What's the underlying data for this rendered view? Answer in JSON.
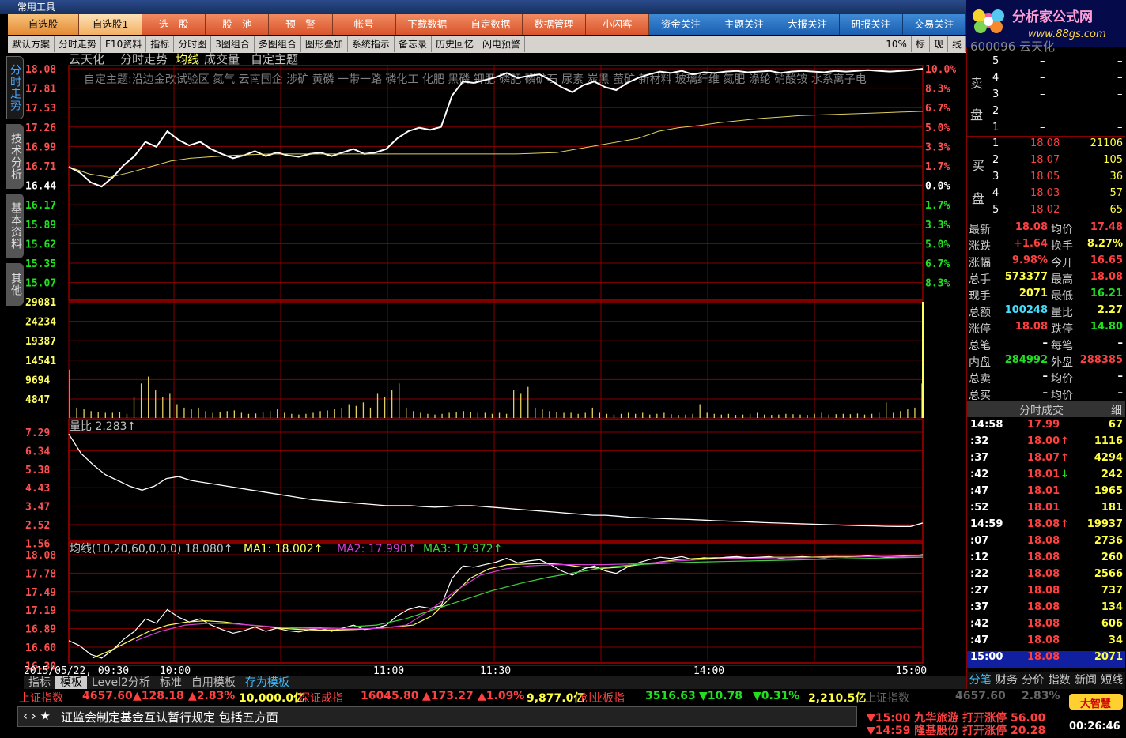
{
  "window": {
    "title": "常用工具"
  },
  "topmenu": [
    {
      "label": "自选股",
      "style": "orange"
    },
    {
      "label": "自选股1",
      "style": "orange sel"
    },
    {
      "label": "选　股",
      "style": "red"
    },
    {
      "label": "股　池",
      "style": "red"
    },
    {
      "label": "预　警",
      "style": "red"
    },
    {
      "label": "帐号",
      "style": "red"
    },
    {
      "label": "下载数据",
      "style": "red"
    },
    {
      "label": "自定数据",
      "style": "red"
    },
    {
      "label": "数据管理",
      "style": "red"
    },
    {
      "label": "小闪客",
      "style": "red"
    },
    {
      "label": "资金关注",
      "style": "blue"
    },
    {
      "label": "主题关注",
      "style": "blue"
    },
    {
      "label": "大报关注",
      "style": "blue"
    },
    {
      "label": "研报关注",
      "style": "blue"
    },
    {
      "label": "交易关注",
      "style": "blue"
    }
  ],
  "logo": {
    "text": "分析家公式网",
    "url": "www.88gs.com"
  },
  "toolbar": {
    "items": [
      "默认方案",
      "分时走势",
      "F10资料",
      "指标",
      "分时图",
      "3图组合",
      "多图组合",
      "图形叠加",
      "系统指示",
      "备忘录",
      "历史回忆",
      "闪电预警"
    ],
    "right": [
      "10%",
      "标",
      "现",
      "线"
    ]
  },
  "lefttabs": [
    "分时走势",
    "技术分析",
    "基本资料",
    "其他"
  ],
  "chart": {
    "header": {
      "stock": "云天化",
      "items": [
        "分时走势",
        "均线",
        "成交量",
        "自定主题"
      ]
    },
    "theme": "自定主题:沿边金改试验区 氮气 云南国企 涉矿 黄磷 一带一路 磷化工 化肥 黑磷 钾肥 磷肥 磷矿石 尿素 炭黑 萤矿 新材料 玻璃纤维 氮肥 涤纶 硝酸铵 水系离子电",
    "price_labels": [
      "18.08",
      "17.81",
      "17.53",
      "17.26",
      "16.99",
      "16.71",
      "16.44",
      "16.17",
      "15.89",
      "15.62",
      "15.35",
      "15.07"
    ],
    "pct_labels": [
      "10.0%",
      "8.3%",
      "6.7%",
      "5.0%",
      "3.3%",
      "1.7%",
      "0.0%",
      "1.7%",
      "3.3%",
      "5.0%",
      "6.7%",
      "8.3%"
    ],
    "vol_labels": [
      "29081",
      "24234",
      "19387",
      "14541",
      "9694",
      "4847"
    ],
    "lb_header": "量比 2.283↑",
    "lb_labels": [
      "7.29",
      "6.34",
      "5.38",
      "4.43",
      "3.47",
      "2.52",
      "1.56"
    ],
    "ma_header": {
      "main": "均线(10,20,60,0,0,0) 18.080↑",
      "ma1": "MA1: 18.002↑",
      "ma2": "MA2: 17.990↑",
      "ma3": "MA3: 17.972↑"
    },
    "ma_labels": [
      "18.08",
      "17.78",
      "17.49",
      "17.19",
      "16.89",
      "16.60",
      "16.30"
    ],
    "time_labels": [
      "2015/05/22, 09:30",
      "10:00",
      "11:00",
      "11:30",
      "14:00",
      "15:00"
    ]
  },
  "bottomtabs": [
    "指标",
    "模板",
    "Level2分析",
    "标准",
    "自用模板",
    "存为模板"
  ],
  "right": {
    "code": "600096 云天化",
    "sell_label": [
      "卖",
      "盘"
    ],
    "buy_label": [
      "买",
      "盘"
    ],
    "sell": [
      {
        "n": "5",
        "p": "–",
        "v": "–"
      },
      {
        "n": "4",
        "p": "–",
        "v": "–"
      },
      {
        "n": "3",
        "p": "–",
        "v": "–"
      },
      {
        "n": "2",
        "p": "–",
        "v": "–"
      },
      {
        "n": "1",
        "p": "–",
        "v": "–"
      }
    ],
    "buy": [
      {
        "n": "1",
        "p": "18.08",
        "v": "21106"
      },
      {
        "n": "2",
        "p": "18.07",
        "v": "105"
      },
      {
        "n": "3",
        "p": "18.05",
        "v": "36"
      },
      {
        "n": "4",
        "p": "18.03",
        "v": "57"
      },
      {
        "n": "5",
        "p": "18.02",
        "v": "65"
      }
    ],
    "stats": [
      {
        "k1": "最新",
        "v1": "18.08",
        "c1": "red",
        "k2": "均价",
        "v2": "17.48",
        "c2": "red"
      },
      {
        "k1": "涨跌",
        "v1": "+1.64",
        "c1": "red",
        "k2": "换手",
        "v2": "8.27%",
        "c2": "yel"
      },
      {
        "k1": "涨幅",
        "v1": "9.98%",
        "c1": "red",
        "k2": "今开",
        "v2": "16.65",
        "c2": "red"
      },
      {
        "k1": "总手",
        "v1": "573377",
        "c1": "yel",
        "k2": "最高",
        "v2": "18.08",
        "c2": "red"
      },
      {
        "k1": "现手",
        "v1": "2071",
        "c1": "yel",
        "k2": "最低",
        "v2": "16.21",
        "c2": "green"
      },
      {
        "k1": "总额",
        "v1": "100248",
        "c1": "cyan",
        "k2": "量比",
        "v2": "2.27",
        "c2": "yel"
      },
      {
        "k1": "涨停",
        "v1": "18.08",
        "c1": "red",
        "k2": "跌停",
        "v2": "14.80",
        "c2": "green"
      },
      {
        "k1": "总笔",
        "v1": "–",
        "c1": "wht",
        "k2": "每笔",
        "v2": "–",
        "c2": "wht"
      },
      {
        "k1": "内盘",
        "v1": "284992",
        "c1": "green",
        "k2": "外盘",
        "v2": "288385",
        "c2": "red"
      },
      {
        "k1": "总卖",
        "v1": "–",
        "c1": "wht",
        "k2": "均价",
        "v2": "–",
        "c2": "wht"
      },
      {
        "k1": "总买",
        "v1": "–",
        "c1": "wht",
        "k2": "均价",
        "v2": "–",
        "c2": "wht"
      }
    ],
    "trades_title": "分时成交",
    "trades_btn": "细",
    "trades": [
      {
        "t": "14:58",
        "p": "17.99",
        "a": "",
        "v": "67"
      },
      {
        "t": ":32",
        "p": "18.00",
        "a": "↑",
        "v": "1116"
      },
      {
        "t": ":37",
        "p": "18.07",
        "a": "↑",
        "v": "4294"
      },
      {
        "t": ":42",
        "p": "18.01",
        "a": "↓",
        "v": "242"
      },
      {
        "t": ":47",
        "p": "18.01",
        "a": "",
        "v": "1965"
      },
      {
        "t": ":52",
        "p": "18.01",
        "a": "",
        "v": "181"
      },
      {
        "t": "14:59",
        "p": "18.08",
        "a": "↑",
        "v": "19937"
      },
      {
        "t": ":07",
        "p": "18.08",
        "a": "",
        "v": "2736"
      },
      {
        "t": ":12",
        "p": "18.08",
        "a": "",
        "v": "260"
      },
      {
        "t": ":22",
        "p": "18.08",
        "a": "",
        "v": "2566"
      },
      {
        "t": ":27",
        "p": "18.08",
        "a": "",
        "v": "737"
      },
      {
        "t": ":37",
        "p": "18.08",
        "a": "",
        "v": "134"
      },
      {
        "t": ":42",
        "p": "18.08",
        "a": "",
        "v": "606"
      },
      {
        "t": ":47",
        "p": "18.08",
        "a": "",
        "v": "34"
      },
      {
        "t": "15:00",
        "p": "18.08",
        "a": "",
        "v": "2071"
      }
    ],
    "bottom_tabs": [
      "分笔",
      "财务",
      "分价",
      "指数",
      "新闻",
      "短线"
    ]
  },
  "status": {
    "idx1": {
      "name": "上证指数",
      "v": "4657.60",
      "chg": "▲128.18",
      "pct": "▲2.83%",
      "amt": "10,000.0亿"
    },
    "idx2": {
      "name": "深证成指",
      "v": "16045.80",
      "chg": "▲173.27",
      "pct": "▲1.09%",
      "amt": "9,877.0亿"
    },
    "idx3": {
      "name": "创业板指",
      "v": "3516.63",
      "chg": "▼10.78",
      "pct": "▼0.31%",
      "amt": "2,210.5亿"
    },
    "idx4": {
      "name": "上证指数",
      "v": "4657.60",
      "pct": "2.83%"
    },
    "news": "证监会制定基金互认暂行规定 包括五方面",
    "alert1": "▼15:00 九华旅游 打开涨停 56.00",
    "alert2": "▼14:59 隆基股份 打开涨停 20.28",
    "brand": "大智慧",
    "clock": "00:26:46"
  }
}
